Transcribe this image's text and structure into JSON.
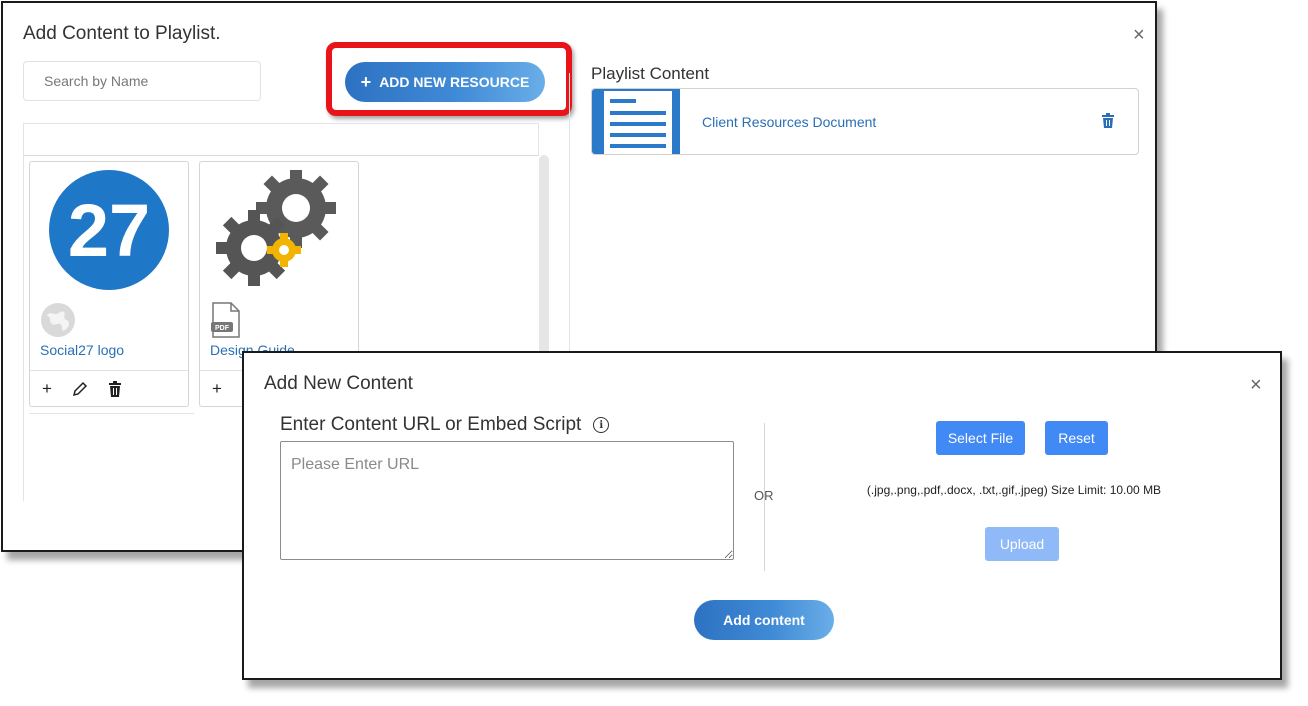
{
  "playlist_dialog": {
    "title": "Add Content to Playlist.",
    "close_label": "×",
    "search_placeholder": "Search by Name",
    "add_resource_button": "ADD NEW RESOURCE",
    "add_resource_icon": "+",
    "resources": [
      {
        "name": "Social27 logo",
        "thumb_text": "27",
        "type_icon": "globe-icon",
        "thumb_color": "#1f77c7"
      },
      {
        "name": "Design Guide",
        "type_icon": "pdf-file-icon",
        "type_label": "PDF"
      }
    ],
    "card_actions": [
      "+",
      "edit-icon",
      "trash-icon"
    ],
    "playlist_title": "Playlist Content",
    "playlist_items": [
      {
        "name": "Client Resources Document",
        "thumb_icon": "document-icon"
      }
    ]
  },
  "add_content_dialog": {
    "title": "Add New Content",
    "close_label": "×",
    "url_label": "Enter Content URL or Embed Script",
    "url_placeholder": "Please Enter URL",
    "or_label": "OR",
    "select_file_button": "Select File",
    "reset_button": "Reset",
    "file_limits": "(.jpg,.png,.pdf,.docx, .txt,.gif,.jpeg) Size Limit: 10.00 MB",
    "upload_button": "Upload",
    "add_content_button": "Add content"
  },
  "colors": {
    "accent_blue": "#4189f5",
    "link_blue": "#2a6fb5",
    "highlight_red": "#e8141a"
  }
}
